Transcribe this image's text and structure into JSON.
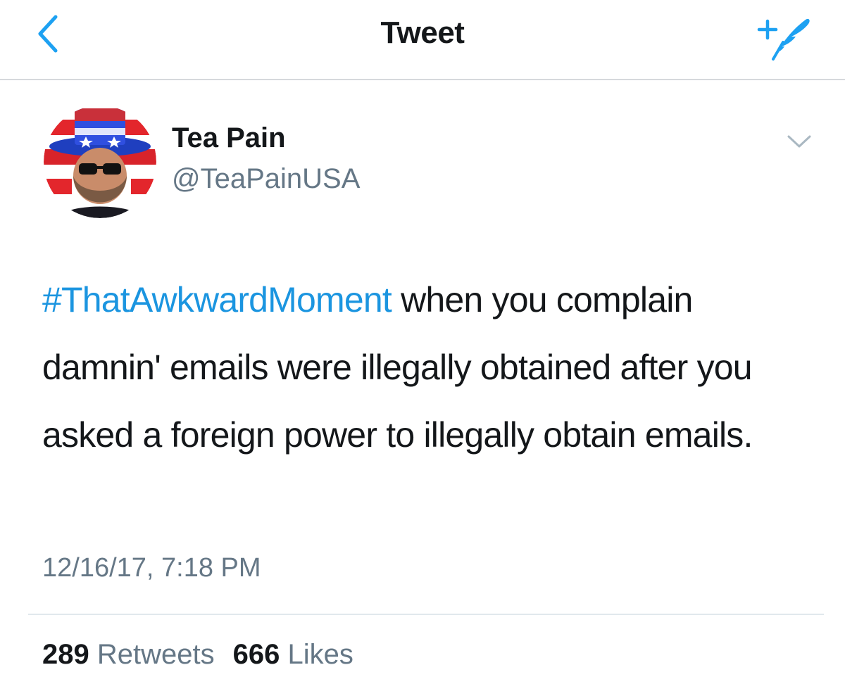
{
  "navbar": {
    "title": "Tweet",
    "back_icon": "chevron-left-icon",
    "compose_icon": "compose-tweet-icon",
    "accent_color": "#1DA1F2"
  },
  "tweet": {
    "author": {
      "display_name": "Tea Pain",
      "handle": "@TeaPainUSA"
    },
    "menu_icon": "chevron-down-icon",
    "hashtag": "#ThatAwkwardMoment",
    "text": " when you complain damnin' emails were illegally obtained after you asked a foreign power to illegally obtain emails.",
    "hashtag_color": "#1B95E0",
    "timestamp": "12/16/17, 7:18 PM",
    "stats": {
      "retweets_count": "289",
      "retweets_label": "Retweets",
      "likes_count": "666",
      "likes_label": "Likes"
    }
  }
}
